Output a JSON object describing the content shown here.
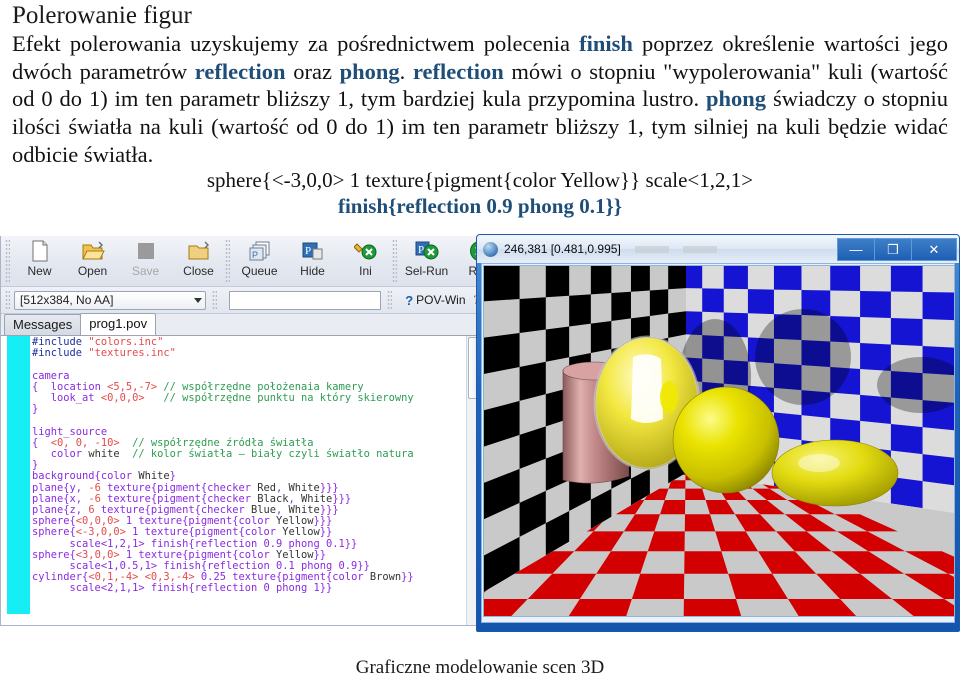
{
  "slide": {
    "title": "Polerowanie figur",
    "paragraph1_parts": [
      {
        "t": "Efekt polerowania uzyskujemy za pośrednictwem polecenia ",
        "kw": false
      },
      {
        "t": "finish",
        "kw": true
      },
      {
        "t": " poprzez określenie wartości jego dwóch parametrów ",
        "kw": false
      },
      {
        "t": "reflection",
        "kw": true
      },
      {
        "t": " oraz ",
        "kw": false
      },
      {
        "t": "phong",
        "kw": true
      },
      {
        "t": ". ",
        "kw": false
      },
      {
        "t": "reflection",
        "kw": true
      },
      {
        "t": " mówi o stopniu \"wypolerowania\" kuli (wartość od  0 do 1) im ten parametr bliższy 1, tym bardziej kula przypomina lustro. ",
        "kw": false
      },
      {
        "t": "phong",
        "kw": true
      },
      {
        "t": " świadczy o stopniu ilości światła na kuli (wartość od 0 do 1) im ten parametr bliższy 1, tym silniej na kuli będzie widać odbicie światła.",
        "kw": false
      }
    ],
    "code_line1": "sphere{<-3,0,0> 1 texture{pigment{color Yellow}}  scale<1,2,1>",
    "code_line2": "finish{reflection 0.9 phong 0.1}}",
    "footer": "Graficzne modelowanie scen 3D",
    "accent_color": "#1f4e79"
  },
  "povray": {
    "toolbar": [
      {
        "label": "New",
        "icon": "new-file-icon",
        "enabled": true
      },
      {
        "label": "Open",
        "icon": "open-folder-icon",
        "enabled": true
      },
      {
        "label": "Save",
        "icon": "save-icon",
        "enabled": false
      },
      {
        "label": "Close",
        "icon": "close-folder-icon",
        "enabled": true
      },
      {
        "label": "Queue",
        "icon": "queue-icon",
        "enabled": true
      },
      {
        "label": "Hide",
        "icon": "hide-icon",
        "enabled": true
      },
      {
        "label": "Ini",
        "icon": "ini-icon",
        "enabled": true
      },
      {
        "label": "Sel-Run",
        "icon": "sel-run-icon",
        "enabled": true
      },
      {
        "label": "Run",
        "icon": "run-icon",
        "enabled": true
      }
    ],
    "resolution_combo": "[512x384, No AA]",
    "search_field_value": "",
    "search_field_placeholder": "",
    "help_label": "POV-Win",
    "tabs": [
      {
        "label": "Messages",
        "active": false
      },
      {
        "label": "prog1.pov",
        "active": true
      }
    ],
    "code": [
      [
        {
          "t": "#include",
          "c": "pre"
        },
        {
          "t": " ",
          "c": "id"
        },
        {
          "t": "\"colors.inc\"",
          "c": "str"
        }
      ],
      [
        {
          "t": "#include",
          "c": "pre"
        },
        {
          "t": " ",
          "c": "id"
        },
        {
          "t": "\"textures.inc\"",
          "c": "str"
        }
      ],
      [],
      [
        {
          "t": "camera",
          "c": "kw"
        }
      ],
      [
        {
          "t": "{  ",
          "c": "kw"
        },
        {
          "t": "location ",
          "c": "kw"
        },
        {
          "t": "<5,5,-7>",
          "c": "str"
        },
        {
          "t": " ",
          "c": "id"
        },
        {
          "t": "// współrzędne położenaia kamery",
          "c": "com"
        }
      ],
      [
        {
          "t": "   look_at ",
          "c": "kw"
        },
        {
          "t": "<0,0,0>",
          "c": "str"
        },
        {
          "t": "   ",
          "c": "id"
        },
        {
          "t": "// współrzędne punktu na który skierowny",
          "c": "com"
        }
      ],
      [
        {
          "t": "}",
          "c": "kw"
        }
      ],
      [],
      [
        {
          "t": "light_source",
          "c": "kw"
        }
      ],
      [
        {
          "t": "{  ",
          "c": "kw"
        },
        {
          "t": "<0, 0, -10>",
          "c": "str"
        },
        {
          "t": "  ",
          "c": "id"
        },
        {
          "t": "// współrzędne źródła światła",
          "c": "com"
        }
      ],
      [
        {
          "t": "   color ",
          "c": "kw"
        },
        {
          "t": "white",
          "c": "id"
        },
        {
          "t": "  ",
          "c": "id"
        },
        {
          "t": "// kolor światła – biały czyli światło natura",
          "c": "com"
        }
      ],
      [
        {
          "t": "}",
          "c": "kw"
        }
      ],
      [
        {
          "t": "background{color ",
          "c": "kw"
        },
        {
          "t": "White",
          "c": "id"
        },
        {
          "t": "}",
          "c": "kw"
        }
      ],
      [
        {
          "t": "plane{y, ",
          "c": "kw"
        },
        {
          "t": "-6",
          "c": "str"
        },
        {
          "t": " texture{pigment{checker ",
          "c": "kw"
        },
        {
          "t": "Red",
          "c": "id"
        },
        {
          "t": ", ",
          "c": "kw"
        },
        {
          "t": "White",
          "c": "id"
        },
        {
          "t": "}}}",
          "c": "kw"
        }
      ],
      [
        {
          "t": "plane{x, ",
          "c": "kw"
        },
        {
          "t": "-6",
          "c": "str"
        },
        {
          "t": " texture{pigment{checker ",
          "c": "kw"
        },
        {
          "t": "Black",
          "c": "id"
        },
        {
          "t": ", ",
          "c": "kw"
        },
        {
          "t": "White",
          "c": "id"
        },
        {
          "t": "}}}",
          "c": "kw"
        }
      ],
      [
        {
          "t": "plane{z, ",
          "c": "kw"
        },
        {
          "t": "6",
          "c": "str"
        },
        {
          "t": " texture{pigment{checker ",
          "c": "kw"
        },
        {
          "t": "Blue",
          "c": "id"
        },
        {
          "t": ", ",
          "c": "kw"
        },
        {
          "t": "White",
          "c": "id"
        },
        {
          "t": "}}}",
          "c": "kw"
        }
      ],
      [
        {
          "t": "sphere{",
          "c": "kw"
        },
        {
          "t": "<0,0,0>",
          "c": "str"
        },
        {
          "t": " 1 texture{pigment{color ",
          "c": "kw"
        },
        {
          "t": "Yellow",
          "c": "id"
        },
        {
          "t": "}}}",
          "c": "kw"
        }
      ],
      [
        {
          "t": "sphere{",
          "c": "kw"
        },
        {
          "t": "<-3,0,0>",
          "c": "str"
        },
        {
          "t": " 1 texture{pigment{color ",
          "c": "kw"
        },
        {
          "t": "Yellow",
          "c": "id"
        },
        {
          "t": "}}",
          "c": "kw"
        }
      ],
      [
        {
          "t": "      scale<1,2,1>",
          "c": "kw"
        },
        {
          "t": " finish{reflection 0.9 phong 0.1}}",
          "c": "kw"
        }
      ],
      [
        {
          "t": "sphere{",
          "c": "kw"
        },
        {
          "t": "<3,0,0>",
          "c": "str"
        },
        {
          "t": " 1 texture{pigment{color ",
          "c": "kw"
        },
        {
          "t": "Yellow",
          "c": "id"
        },
        {
          "t": "}}",
          "c": "kw"
        }
      ],
      [
        {
          "t": "      scale<1,0.5,1>",
          "c": "kw"
        },
        {
          "t": " finish{reflection 0.1 phong 0.9}}",
          "c": "kw"
        }
      ],
      [
        {
          "t": "cylinder{",
          "c": "kw"
        },
        {
          "t": "<0,1,-4> <0,3,-4>",
          "c": "str"
        },
        {
          "t": " 0.25 texture{pigment{color ",
          "c": "kw"
        },
        {
          "t": "Brown",
          "c": "id"
        },
        {
          "t": "}}",
          "c": "kw"
        }
      ],
      [
        {
          "t": "      scale<2,1,1>",
          "c": "kw"
        },
        {
          "t": " finish{reflection 0 phong 1}}",
          "c": "kw"
        }
      ]
    ]
  },
  "render_window": {
    "title": "246,381 [0.481,0.995]",
    "minimize_label": "—",
    "maximize_label": "❐",
    "close_label": "✕",
    "scene": {
      "floor_checker": [
        "#d20000",
        "#c9c9c9"
      ],
      "left_wall_checker": [
        "#000000",
        "#c9c9c9"
      ],
      "back_wall_checker": [
        "#1414d2",
        "#dcdcdc"
      ],
      "sphere_color": "#e8e000",
      "cylinder_color": "#c08080"
    }
  }
}
